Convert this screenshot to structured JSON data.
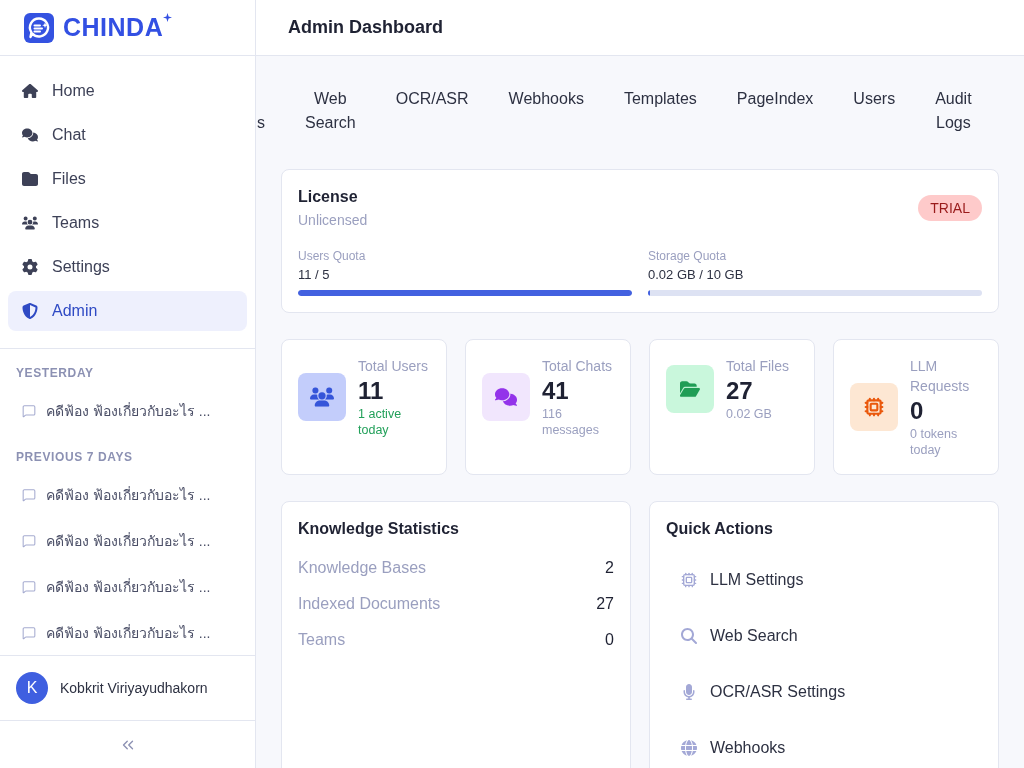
{
  "sidebar": {
    "logo": {
      "text": "CHINDA"
    },
    "nav": [
      {
        "label": "Home",
        "selected": false
      },
      {
        "label": "Chat",
        "selected": false
      },
      {
        "label": "Files",
        "selected": false
      },
      {
        "label": "Teams",
        "selected": false
      },
      {
        "label": "Settings",
        "selected": false
      },
      {
        "label": "Admin",
        "selected": true
      }
    ],
    "history": [
      {
        "heading": "YESTERDAY",
        "chats": [
          "คดีฟ้อง ฟ้องเกี่ยวกับอะไร ..."
        ]
      },
      {
        "heading": "PREVIOUS 7 DAYS",
        "chats": [
          "คดีฟ้อง ฟ้องเกี่ยวกับอะไร ...",
          "คดีฟ้อง ฟ้องเกี่ยวกับอะไร ...",
          "คดีฟ้อง ฟ้องเกี่ยวกับอะไร ...",
          "คดีฟ้อง ฟ้องเกี่ยวกับอะไร ..."
        ]
      }
    ],
    "user": {
      "initial": "K",
      "name": "Kobkrit Viriyayudhakorn"
    }
  },
  "header": {
    "title": "Admin Dashboard"
  },
  "tabs": [
    {
      "label": "s"
    },
    {
      "label": "Web Search"
    },
    {
      "label": "OCR/ASR"
    },
    {
      "label": "Webhooks"
    },
    {
      "label": "Templates"
    },
    {
      "label": "PageIndex"
    },
    {
      "label": "Users"
    },
    {
      "label": "Audit Logs"
    }
  ],
  "license": {
    "title": "License",
    "status": "Unlicensed",
    "badge": "TRIAL",
    "quotas": [
      {
        "label": "Users Quota",
        "reading": "11 / 5",
        "level": 1
      },
      {
        "label": "Storage Quota",
        "reading": "0.02 GB / 10 GB",
        "level": 0.005
      }
    ]
  },
  "stats": [
    {
      "label": "Total Users",
      "value": "11",
      "sub": "1 active today",
      "sub_highlighted": true
    },
    {
      "label": "Total Chats",
      "value": "41",
      "sub": "116 messages",
      "sub_highlighted": false
    },
    {
      "label": "Total Files",
      "value": "27",
      "sub": "0.02 GB",
      "sub_highlighted": false
    },
    {
      "label": "LLM Requests",
      "value": "0",
      "sub": "0 tokens today",
      "sub_highlighted": false
    }
  ],
  "knowledge": {
    "title": "Knowledge Statistics",
    "rows": [
      {
        "label": "Knowledge Bases",
        "value": "2"
      },
      {
        "label": "Indexed Documents",
        "value": "27"
      },
      {
        "label": "Teams",
        "value": "0"
      }
    ]
  },
  "quick_actions": {
    "title": "Quick Actions",
    "items": [
      {
        "label": "LLM Settings"
      },
      {
        "label": "Web Search"
      },
      {
        "label": "OCR/ASR Settings"
      },
      {
        "label": "Webhooks"
      }
    ]
  }
}
